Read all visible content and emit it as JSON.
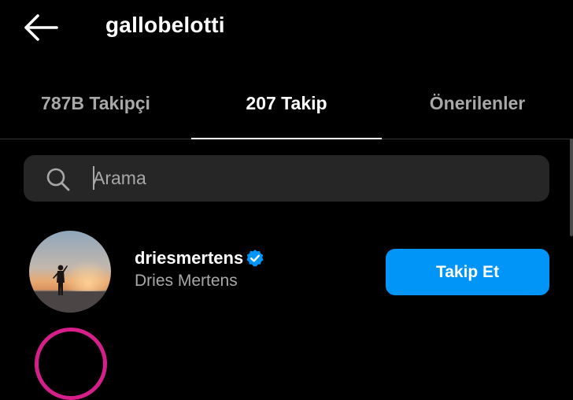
{
  "header": {
    "username": "gallobelotti",
    "back_icon": "back-arrow-icon"
  },
  "tabs": [
    {
      "label": "787B Takipçi",
      "active": false
    },
    {
      "label": "207 Takip",
      "active": true
    },
    {
      "label": "Önerilenler",
      "active": false
    }
  ],
  "search": {
    "placeholder": "Arama",
    "value": "",
    "icon": "search-icon"
  },
  "following_list": [
    {
      "username": "driesmertens",
      "full_name": "Dries Mertens",
      "verified": true,
      "button_label": "Takip Et"
    }
  ],
  "colors": {
    "background": "#000000",
    "primary_button": "#0095f6",
    "secondary_text": "#a8a8a8",
    "search_bg": "#262626",
    "verified_badge": "#0095f6",
    "story_ring": "#d61f8a"
  }
}
